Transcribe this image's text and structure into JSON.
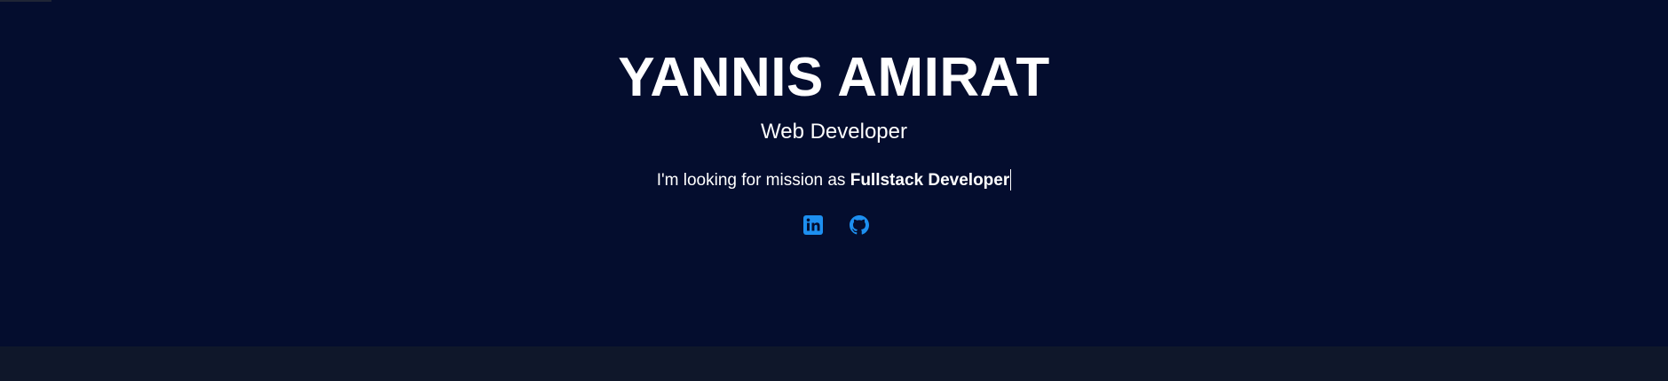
{
  "hero": {
    "name": "YANNIS AMIRAT",
    "role": "Web Developer",
    "mission_prefix": "I'm looking for mission as ",
    "mission_highlight": "Fullstack Developer"
  },
  "socials": [
    {
      "icon": "linkedin-icon"
    },
    {
      "icon": "github-icon"
    }
  ],
  "colors": {
    "hero_background": "#040d2e",
    "page_background": "#0f172a",
    "text": "#ffffff",
    "icon_accent": "#1d8ff0"
  }
}
